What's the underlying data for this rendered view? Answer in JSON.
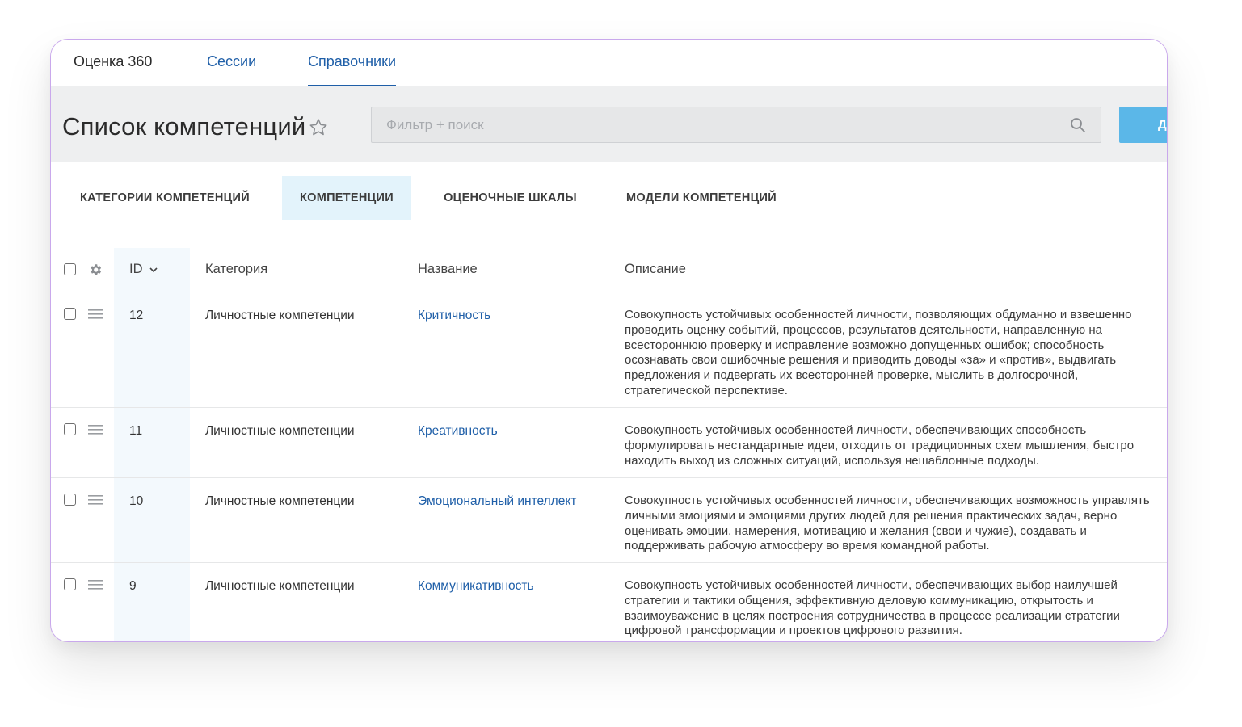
{
  "topnav": {
    "tabs": [
      {
        "label": "Оценка 360"
      },
      {
        "label": "Сессии"
      },
      {
        "label": "Справочники"
      }
    ]
  },
  "header": {
    "title": "Список компетенций",
    "search_placeholder": "Фильтр + поиск",
    "add_button_label": "Д"
  },
  "subtabs": [
    {
      "label": "Категории компетенций"
    },
    {
      "label": "Компетенции",
      "active": true
    },
    {
      "label": "Оценочные шкалы"
    },
    {
      "label": "Модели компетенций"
    }
  ],
  "table": {
    "columns": {
      "id": "ID",
      "category": "Категория",
      "name": "Название",
      "description": "Описание"
    },
    "rows": [
      {
        "id": "12",
        "category": "Личностные компетенции",
        "name": "Критичность",
        "description": "Совокупность устойчивых особенностей личности, позволяющих обдуманно и взвешенно проводить оценку событий, процессов, результатов деятельности, направленную на всестороннюю проверку и исправление возможно допущенных ошибок; способность осознавать свои ошибочные решения и приводить доводы «за» и «против», выдвигать предложения и подвергать их всесторонней проверке, мыслить в долгосрочной, стратегической перспективе."
      },
      {
        "id": "11",
        "category": "Личностные компетенции",
        "name": "Креативность",
        "description": "Совокупность устойчивых особенностей личности, обеспечивающих способность формулировать нестандартные идеи, отходить от традиционных схем мышления, быстро находить выход из сложных ситуаций, используя нешаблонные подходы."
      },
      {
        "id": "10",
        "category": "Личностные компетенции",
        "name": "Эмоциональный интеллект",
        "description": "Совокупность устойчивых особенностей личности, обеспечивающих возможность управлять личными эмоциями и эмоциями других людей для решения практических задач, верно оценивать эмоции, намерения, мотивацию и желания (свои и чужие), создавать и поддерживать рабочую атмосферу во время командной работы."
      },
      {
        "id": "9",
        "category": "Личностные компетенции",
        "name": "Коммуникативность",
        "description": "Совокупность устойчивых особенностей личности, обеспечивающих выбор наилучшей стратегии и тактики общения, эффективную деловую коммуникацию, открытость и взаимоуважение в целях построения сотрудничества в процессе реализации стратегии цифровой трансформации и проектов цифрового развития."
      }
    ]
  },
  "colors": {
    "accent": "#1f5fa8",
    "button": "#5bb7e8",
    "active_subtab": "#e3f3fb",
    "frame_border": "#c9a8ec"
  }
}
